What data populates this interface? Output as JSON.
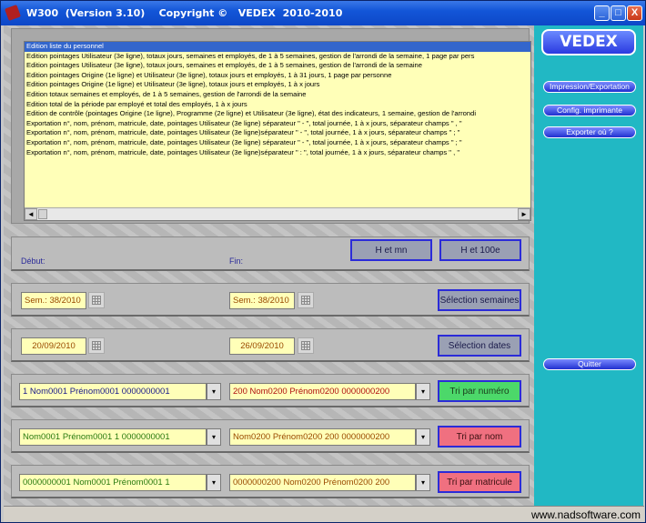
{
  "window": {
    "title": "W300  (Version 3.10)    Copyright ©   VEDEX  2010-2010",
    "buttons": {
      "minimize": "_",
      "maximize": "□",
      "close": "X"
    }
  },
  "list": {
    "items": [
      "Edition liste du personnel",
      "Edition pointages Utilisateur (3e ligne), totaux jours, semaines et employés, de 1 à 5 semaines, gestion de l'arrondi de la semaine, 1 page par pers",
      "Edition pointages Utilisateur (3e ligne), totaux jours, semaines et employés, de 1 à 5 semaines, gestion de l'arrondi de la semaine",
      "Edition pointages Origine (1e ligne) et Utilisateur (3e ligne), totaux jours et employés, 1 à 31 jours, 1 page par personne",
      "Edition pointages Origine (1e ligne) et Utilisateur (3e ligne), totaux jours et employés, 1 à x jours",
      "Edition totaux semaines et employés, de 1 à 5 semaines, gestion de l'arrondi de la semaine",
      "Edition total de la période par employé et total des employés, 1 à x jours",
      "Edition de contrôle (pointages Origine (1e ligne), Programme (2e ligne) et Utilisateur (3e ligne), état des indicateurs, 1 semaine, gestion de l'arrondi",
      "Exportation n°, nom, prénom, matricule, date, pointages Utilisateur (3e ligne) séparateur \" - \", total journée, 1 à x jours, séparateur champs \" , \"",
      "Exportation n°, nom, prénom, matricule, date, pointages Utilisateur (3e ligne)séparateur \" - \", total journée, 1 à x jours, séparateur champs \" ; \"",
      "Exportation n°, nom, prénom, matricule, date, pointages Utilisateur (3e ligne) séparateur \" - \", total journée, 1 à x jours, séparateur champs \" ; \"",
      "Exportation n°, nom, prénom, matricule, date, pointages Utilisateur (3e ligne)séparateur \" : \", total journée, 1 à x jours, séparateur champs \" , \""
    ],
    "selected_index": 0,
    "scroll_left": "◄",
    "scroll_right": "►"
  },
  "period": {
    "debut_label": "Début:",
    "fin_label": "Fin:",
    "btn_h_mn": "H et mn",
    "btn_h_100": "H et 100e"
  },
  "weeks": {
    "start": "Sem.: 38/2010",
    "end": "Sem.: 38/2010",
    "button": "Sélection semaines"
  },
  "dates": {
    "start": "20/09/2010",
    "end": "26/09/2010",
    "button": "Sélection dates"
  },
  "sort_number": {
    "from": "1 Nom0001  Prénom0001  0000000001",
    "to": "200 Nom0200  Prénom0200  0000000200",
    "button": "Tri par numéro"
  },
  "sort_name": {
    "from": "Nom0001  Prénom0001  1  0000000001",
    "to": "Nom0200  Prénom0200  200  0000000200",
    "button": "Tri par nom"
  },
  "sort_matricule": {
    "from": "0000000001  Nom0001  Prénom0001  1",
    "to": "0000000200  Nom0200  Prénom0200  200",
    "button": "Tri par matricule"
  },
  "sidebar": {
    "logo": "VEDEX",
    "impression": "Impression/Exportation",
    "config": "Config. imprimante",
    "exporter": "Exporter où ?",
    "quitter": "Quitter"
  },
  "statusbar": {
    "site": "www.nadsoftware.com"
  },
  "icons": {
    "app": "app-icon",
    "calendar": "calendar-icon",
    "dropdown": "chevron-down-icon"
  },
  "colors": {
    "list_bg": "#ffffb8",
    "sidebar_bg": "#21b8c4",
    "button_border": "#2b2bd8",
    "sort_green": "#4cd86a",
    "sort_red": "#f07080"
  }
}
